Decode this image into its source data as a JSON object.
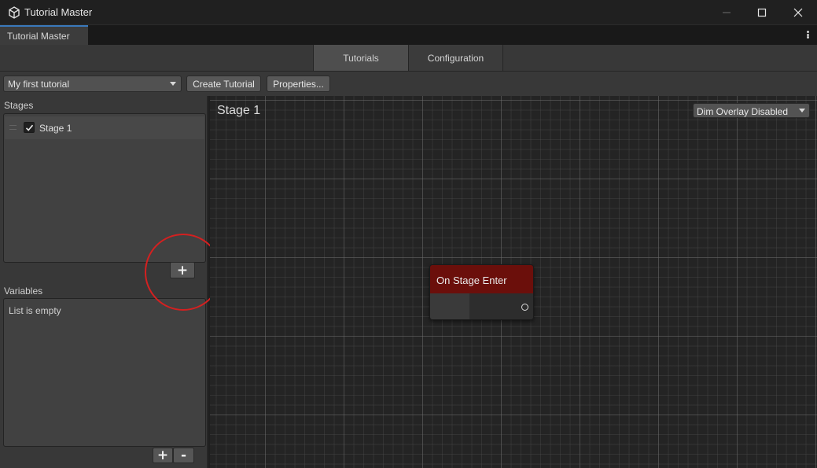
{
  "window": {
    "title": "Tutorial Master",
    "icon": "unity-cube-icon",
    "controls": [
      "minimize-icon",
      "maximize-icon",
      "close-icon"
    ]
  },
  "doc_tab": {
    "label": "Tutorial Master",
    "menu_icon": "kebab-menu-icon"
  },
  "tabs": [
    {
      "label": "Tutorials",
      "active": true
    },
    {
      "label": "Configuration",
      "active": false
    }
  ],
  "toolbar": {
    "tutorial_select": "My first tutorial",
    "create_label": "Create Tutorial",
    "properties_label": "Properties..."
  },
  "stages": {
    "label": "Stages",
    "items": [
      {
        "label": "Stage 1",
        "checked": true
      }
    ],
    "add_label": "+"
  },
  "variables": {
    "label": "Variables",
    "empty_text": "List is empty",
    "add_label": "+",
    "remove_label": "-"
  },
  "canvas": {
    "title": "Stage 1",
    "overlay_select": "Dim Overlay Disabled"
  },
  "node": {
    "title": "On Stage Enter",
    "header_color": "#6b0f0b"
  },
  "colors": {
    "accent": "#3a79bb",
    "highlight": "#d42020"
  }
}
